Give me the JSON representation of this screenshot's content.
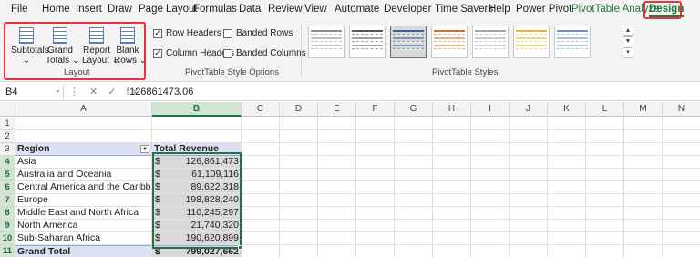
{
  "menu": {
    "tabs": [
      "File",
      "Home",
      "Insert",
      "Draw",
      "Page Layout",
      "Formulas",
      "Data",
      "Review",
      "View",
      "Automate",
      "Developer",
      "Time Savers",
      "Help",
      "Power Pivot",
      "PivotTable Analyze",
      "Design"
    ]
  },
  "ribbon": {
    "layout": {
      "buttons": [
        {
          "l1": "Subtotals",
          "l2": "⌄"
        },
        {
          "l1": "Grand",
          "l2": "Totals ⌄"
        },
        {
          "l1": "Report",
          "l2": "Layout ⌄"
        },
        {
          "l1": "Blank",
          "l2": "Rows ⌄"
        }
      ],
      "label": "Layout"
    },
    "style_options": {
      "row_headers": "Row Headers",
      "column_headers": "Column Headers",
      "banded_rows": "Banded Rows",
      "banded_columns": "Banded Columns",
      "label": "PivotTable Style Options"
    },
    "styles": {
      "label": "PivotTable Styles",
      "colors": [
        "#8c8c8c",
        "#555555",
        "#3b5e9a",
        "#d86c2b",
        "#a5a5a5",
        "#e5b92b",
        "#6a8fc9"
      ]
    }
  },
  "formula_bar": {
    "name_box": "B4",
    "icons": "⋮ ✕ ✓ fx",
    "value": "126861473.06"
  },
  "columns": [
    "A",
    "B",
    "C",
    "D",
    "E",
    "F",
    "G",
    "H",
    "I",
    "J",
    "K",
    "L",
    "M",
    "N"
  ],
  "rows": [
    "1",
    "2",
    "3",
    "4",
    "5",
    "6",
    "7",
    "8",
    "9",
    "10",
    "11"
  ],
  "pivot": {
    "header_region": "Region",
    "header_revenue": "Total Revenue",
    "currency": "$",
    "rows": [
      {
        "region": "Asia",
        "value": "126,861,473"
      },
      {
        "region": "Australia and Oceania",
        "value": "61,109,116"
      },
      {
        "region": "Central America and the Caribbean",
        "value": "89,622,318"
      },
      {
        "region": "Europe",
        "value": "198,828,240"
      },
      {
        "region": "Middle East and North Africa",
        "value": "110,245,297"
      },
      {
        "region": "North America",
        "value": "21,740,320"
      },
      {
        "region": "Sub-Saharan Africa",
        "value": "190,620,899"
      }
    ],
    "total_label": "Grand Total",
    "total_value": "799,027,662"
  }
}
